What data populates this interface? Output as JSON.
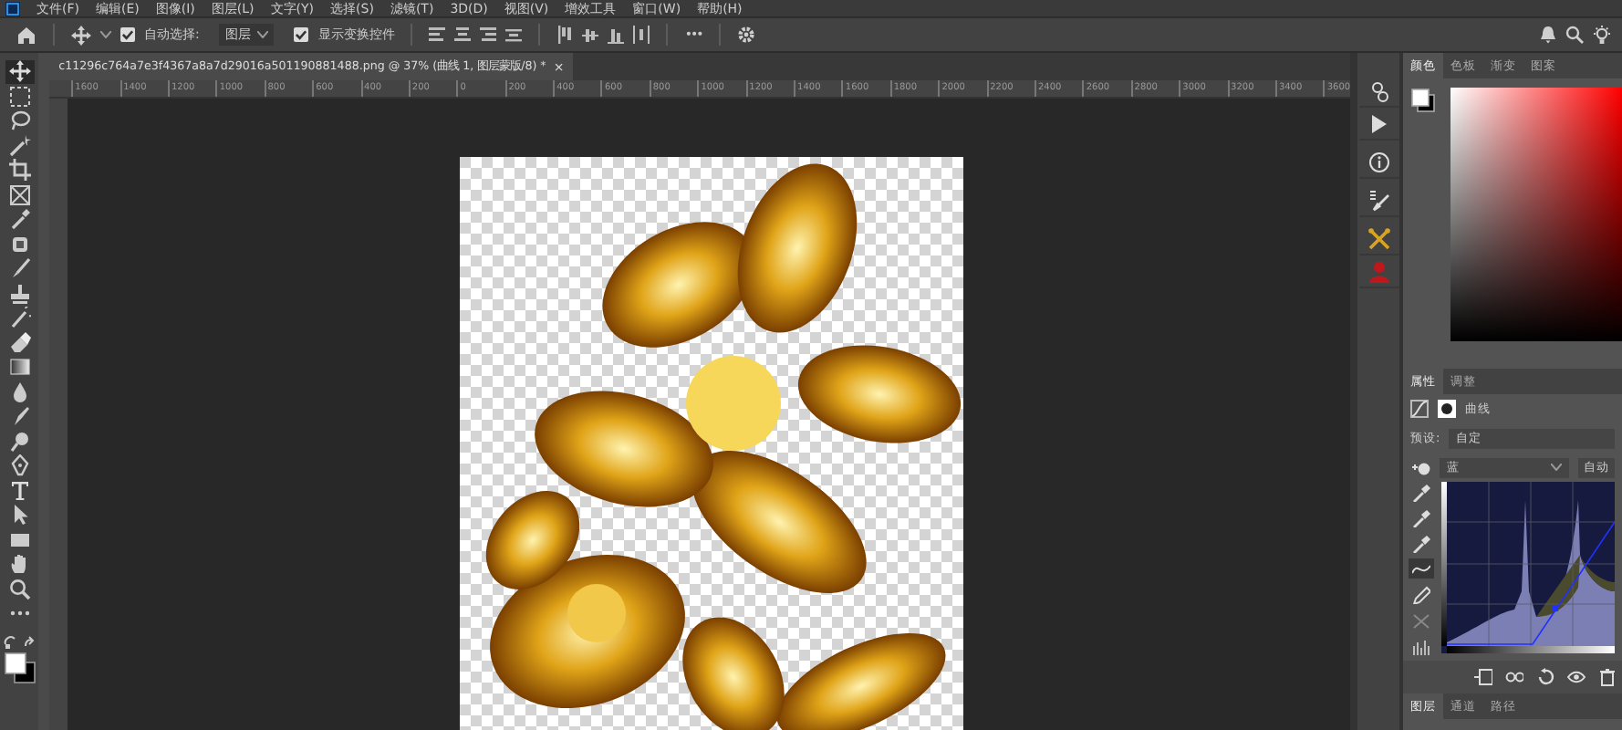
{
  "menu": [
    "文件(F)",
    "编辑(E)",
    "图像(I)",
    "图层(L)",
    "文字(Y)",
    "选择(S)",
    "滤镜(T)",
    "3D(D)",
    "视图(V)",
    "增效工具",
    "窗口(W)",
    "帮助(H)"
  ],
  "options_bar": {
    "auto_select_label": "自动选择:",
    "auto_select": true,
    "target": "图层",
    "show_transform_label": "显示变换控件",
    "show_transform": true,
    "more": "•••"
  },
  "document_tab": {
    "title": "c11296c764a7e3f4367a8a7d29016a501190881488.png @ 37% (曲线 1, 图层蒙版/8) *",
    "close": "×"
  },
  "ruler_labels": [
    "1600",
    "1400",
    "1200",
    "1000",
    "800",
    "600",
    "400",
    "200",
    "0",
    "200",
    "400",
    "600",
    "800",
    "1000",
    "1200",
    "1400",
    "1600",
    "1800",
    "2000",
    "2200",
    "2400",
    "2600",
    "2800",
    "3000",
    "3200",
    "3400",
    "3600"
  ],
  "tools": [
    {
      "kind": "move",
      "selected": true
    },
    {
      "kind": "marquee",
      "selected": false
    },
    {
      "kind": "lasso",
      "selected": false
    },
    {
      "kind": "wand",
      "selected": false
    },
    {
      "kind": "crop",
      "selected": false
    },
    {
      "kind": "frame",
      "selected": false
    },
    {
      "kind": "eyedropper",
      "selected": false
    },
    {
      "kind": "heal",
      "selected": false
    },
    {
      "kind": "brush",
      "selected": false
    },
    {
      "kind": "stamp",
      "selected": false
    },
    {
      "kind": "history",
      "selected": false
    },
    {
      "kind": "eraser",
      "selected": false
    },
    {
      "kind": "gradient",
      "selected": false
    },
    {
      "kind": "blur",
      "selected": false
    },
    {
      "kind": "smudge",
      "selected": false
    },
    {
      "kind": "dodge",
      "selected": false
    },
    {
      "kind": "pen",
      "selected": false
    },
    {
      "kind": "type",
      "selected": false
    },
    {
      "kind": "select",
      "selected": false
    },
    {
      "kind": "rect",
      "selected": false
    },
    {
      "kind": "hand",
      "selected": false
    },
    {
      "kind": "zoom",
      "selected": false
    },
    {
      "kind": "more",
      "selected": false
    }
  ],
  "color_panel": {
    "tabs": [
      {
        "label": "颜色",
        "selected": true
      },
      {
        "label": "色板",
        "selected": false
      },
      {
        "label": "渐变",
        "selected": false
      },
      {
        "label": "图案",
        "selected": false
      }
    ]
  },
  "properties_panel": {
    "tabs": [
      {
        "label": "属性",
        "selected": true
      },
      {
        "label": "调整",
        "selected": false
      }
    ],
    "title": "曲线",
    "preset_label": "预设:",
    "preset": "自定",
    "channel": "蓝",
    "auto": "自动"
  },
  "layers_panel": {
    "tabs": [
      {
        "label": "图层",
        "selected": true
      },
      {
        "label": "通道",
        "selected": false
      },
      {
        "label": "路径",
        "selected": false
      }
    ]
  }
}
